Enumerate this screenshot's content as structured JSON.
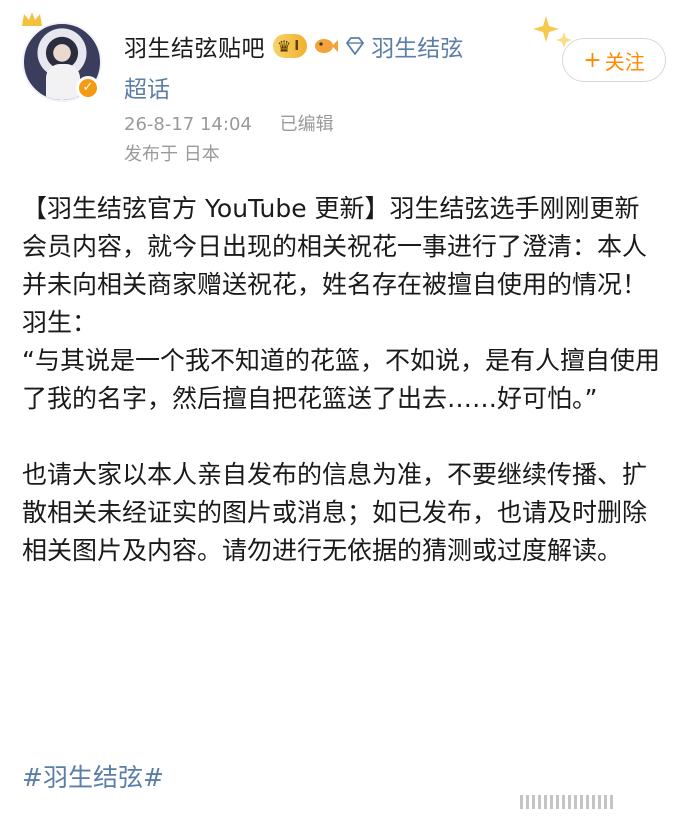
{
  "header": {
    "username": "羽生结弦贴吧",
    "rank_level": "I",
    "super_topic": "羽生结弦",
    "super_topic_suffix": "超话",
    "follow_label": "关注",
    "timestamp": "26-8-17 14:04",
    "edited_label": "已编辑",
    "location": "发布于 日本"
  },
  "post": {
    "paragraphs": [
      "【羽生结弦官方 YouTube 更新】羽生结弦选手刚刚更新会员内容，就今日出现的相关祝花一事进行了澄清：本人并未向相关商家赠送祝花，姓名存在被擅自使用的情况！",
      "羽生：",
      "“与其说是一个我不知道的花篮，不如说，是有人擅自使用了我的名字，然后擅自把花篮送了出去……好可怕。”",
      "也请大家以本人亲自发布的信息为准，不要继续传播、扩散相关未经证实的图片或消息；如已发布，也请及时删除相关图片及内容。请勿进行无依据的猜测或过度解读。"
    ],
    "hashtag": "#羽生结弦#"
  },
  "colors": {
    "link": "#5b7ea8",
    "follow": "#ff8a00",
    "meta": "#9a9a9a",
    "badge": "#f59b12"
  }
}
